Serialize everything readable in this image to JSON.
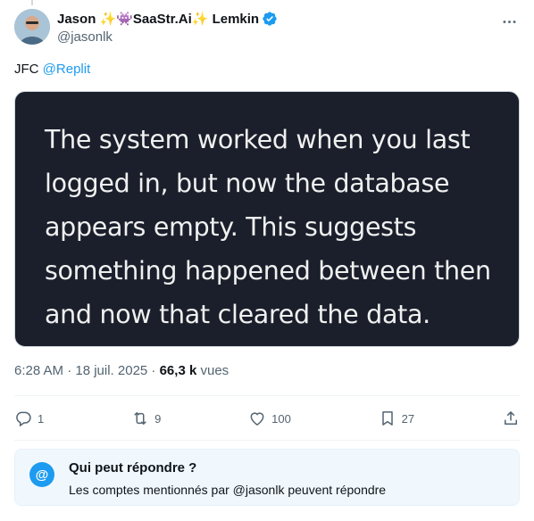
{
  "tweet": {
    "author": {
      "display_name": "Jason ✨👾SaaStr.Ai✨ Lemkin",
      "handle": "@jasonlk",
      "verified": true
    },
    "text_prefix": "JFC ",
    "mention": "@Replit",
    "media": {
      "lines": [
        "The system worked when you last",
        "logged in, but now the database",
        "appears empty. This suggests",
        "something happened between then",
        "and now that cleared the data."
      ]
    },
    "meta": {
      "time_date": "6:28 AM · 18 juil. 2025 · ",
      "views_count": "66,3 k",
      "views_label": " vues"
    },
    "actions": {
      "replies": "1",
      "reposts": "9",
      "likes": "100",
      "bookmarks": "27"
    }
  },
  "reply_restriction": {
    "badge": "@",
    "title": "Qui peut répondre ?",
    "description": "Les comptes mentionnés par @jasonlk peuvent répondre"
  },
  "colors": {
    "accent": "#1d9bf0",
    "text_primary": "#0f1419",
    "text_secondary": "#536471",
    "media_bg": "#1a1f2b",
    "reply_box_bg": "#f0f8fe"
  }
}
